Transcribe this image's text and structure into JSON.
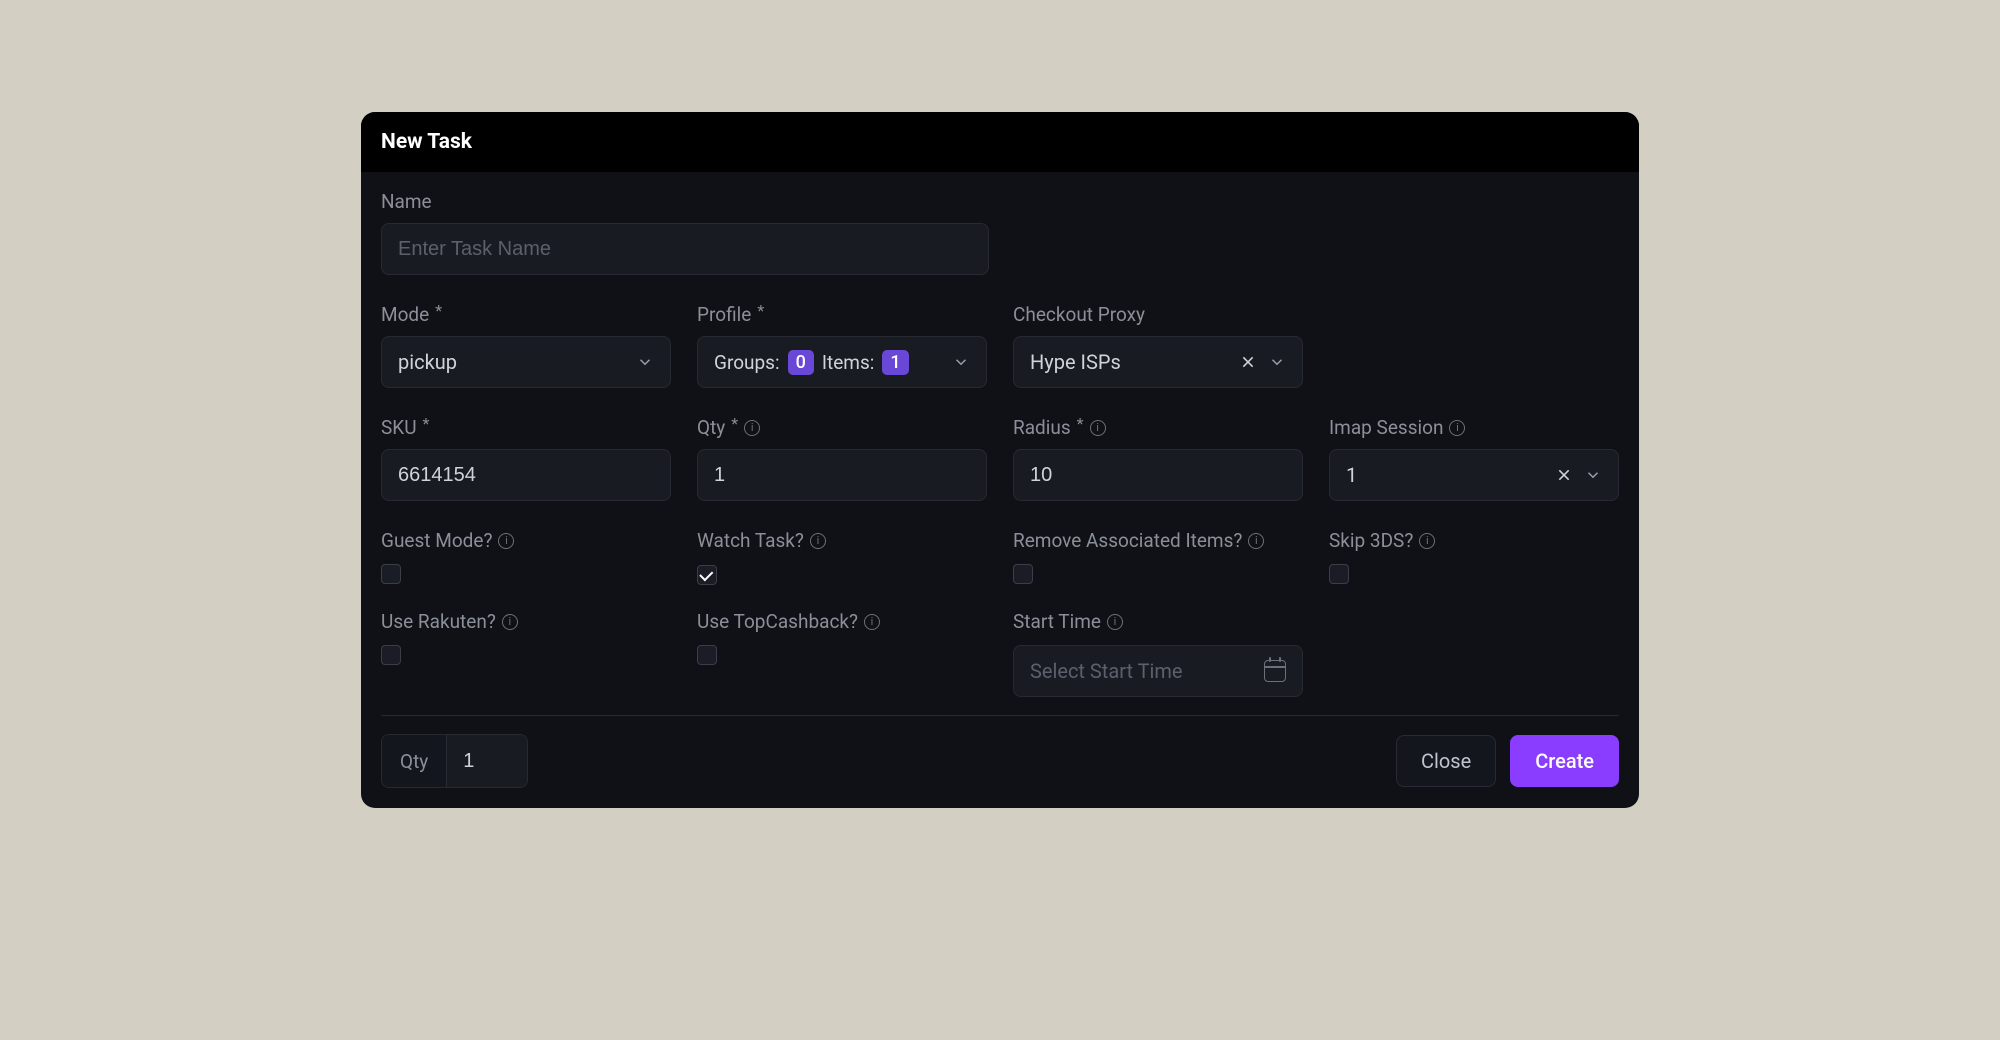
{
  "dialog": {
    "title": "New Task"
  },
  "name": {
    "label": "Name",
    "placeholder": "Enter Task Name",
    "value": ""
  },
  "mode": {
    "label": "Mode",
    "value": "pickup"
  },
  "profile": {
    "label": "Profile",
    "groups_label": "Groups:",
    "groups_count": "0",
    "items_label": "Items:",
    "items_count": "1"
  },
  "checkout_proxy": {
    "label": "Checkout Proxy",
    "value": "Hype ISPs"
  },
  "sku": {
    "label": "SKU",
    "value": "6614154"
  },
  "qty": {
    "label": "Qty",
    "value": "1"
  },
  "radius": {
    "label": "Radius",
    "value": "10"
  },
  "imap": {
    "label": "Imap Session",
    "value": "1"
  },
  "guest_mode": {
    "label": "Guest Mode?",
    "checked": false
  },
  "watch_task": {
    "label": "Watch Task?",
    "checked": true
  },
  "remove_assoc": {
    "label": "Remove Associated Items?",
    "checked": false
  },
  "skip_3ds": {
    "label": "Skip 3DS?",
    "checked": false
  },
  "use_rakuten": {
    "label": "Use Rakuten?",
    "checked": false
  },
  "use_topcashback": {
    "label": "Use TopCashback?",
    "checked": false
  },
  "start_time": {
    "label": "Start Time",
    "placeholder": "Select Start Time"
  },
  "footer": {
    "qty_label": "Qty",
    "qty_value": "1",
    "close": "Close",
    "create": "Create"
  }
}
